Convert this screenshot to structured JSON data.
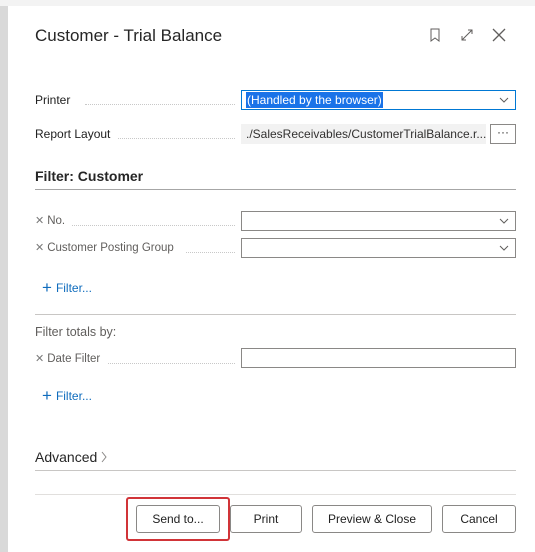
{
  "dialog": {
    "title": "Customer - Trial Balance"
  },
  "header_icons": [
    "bookmark-icon",
    "expand-icon",
    "close-icon"
  ],
  "options": {
    "printer_label": "Printer",
    "printer_value": "(Handled by the browser)",
    "report_layout_label": "Report Layout",
    "report_layout_value": "./SalesReceivables/CustomerTrialBalance.r...",
    "assist_label": "···"
  },
  "filter_customer": {
    "heading": "Filter: Customer",
    "fields": [
      {
        "label": "No.",
        "value": ""
      },
      {
        "label": "Customer Posting Group",
        "value": ""
      }
    ],
    "add_filter_label": "Filter..."
  },
  "filter_totals": {
    "heading": "Filter totals by:",
    "fields": [
      {
        "label": "Date Filter",
        "value": ""
      }
    ],
    "add_filter_label": "Filter..."
  },
  "advanced": {
    "label": "Advanced"
  },
  "buttons": {
    "send_to": "Send to...",
    "print": "Print",
    "preview_close": "Preview & Close",
    "cancel": "Cancel"
  },
  "colors": {
    "accent": "#0f6cbd",
    "selection": "#1a73e8",
    "highlight_box": "#d13438"
  }
}
